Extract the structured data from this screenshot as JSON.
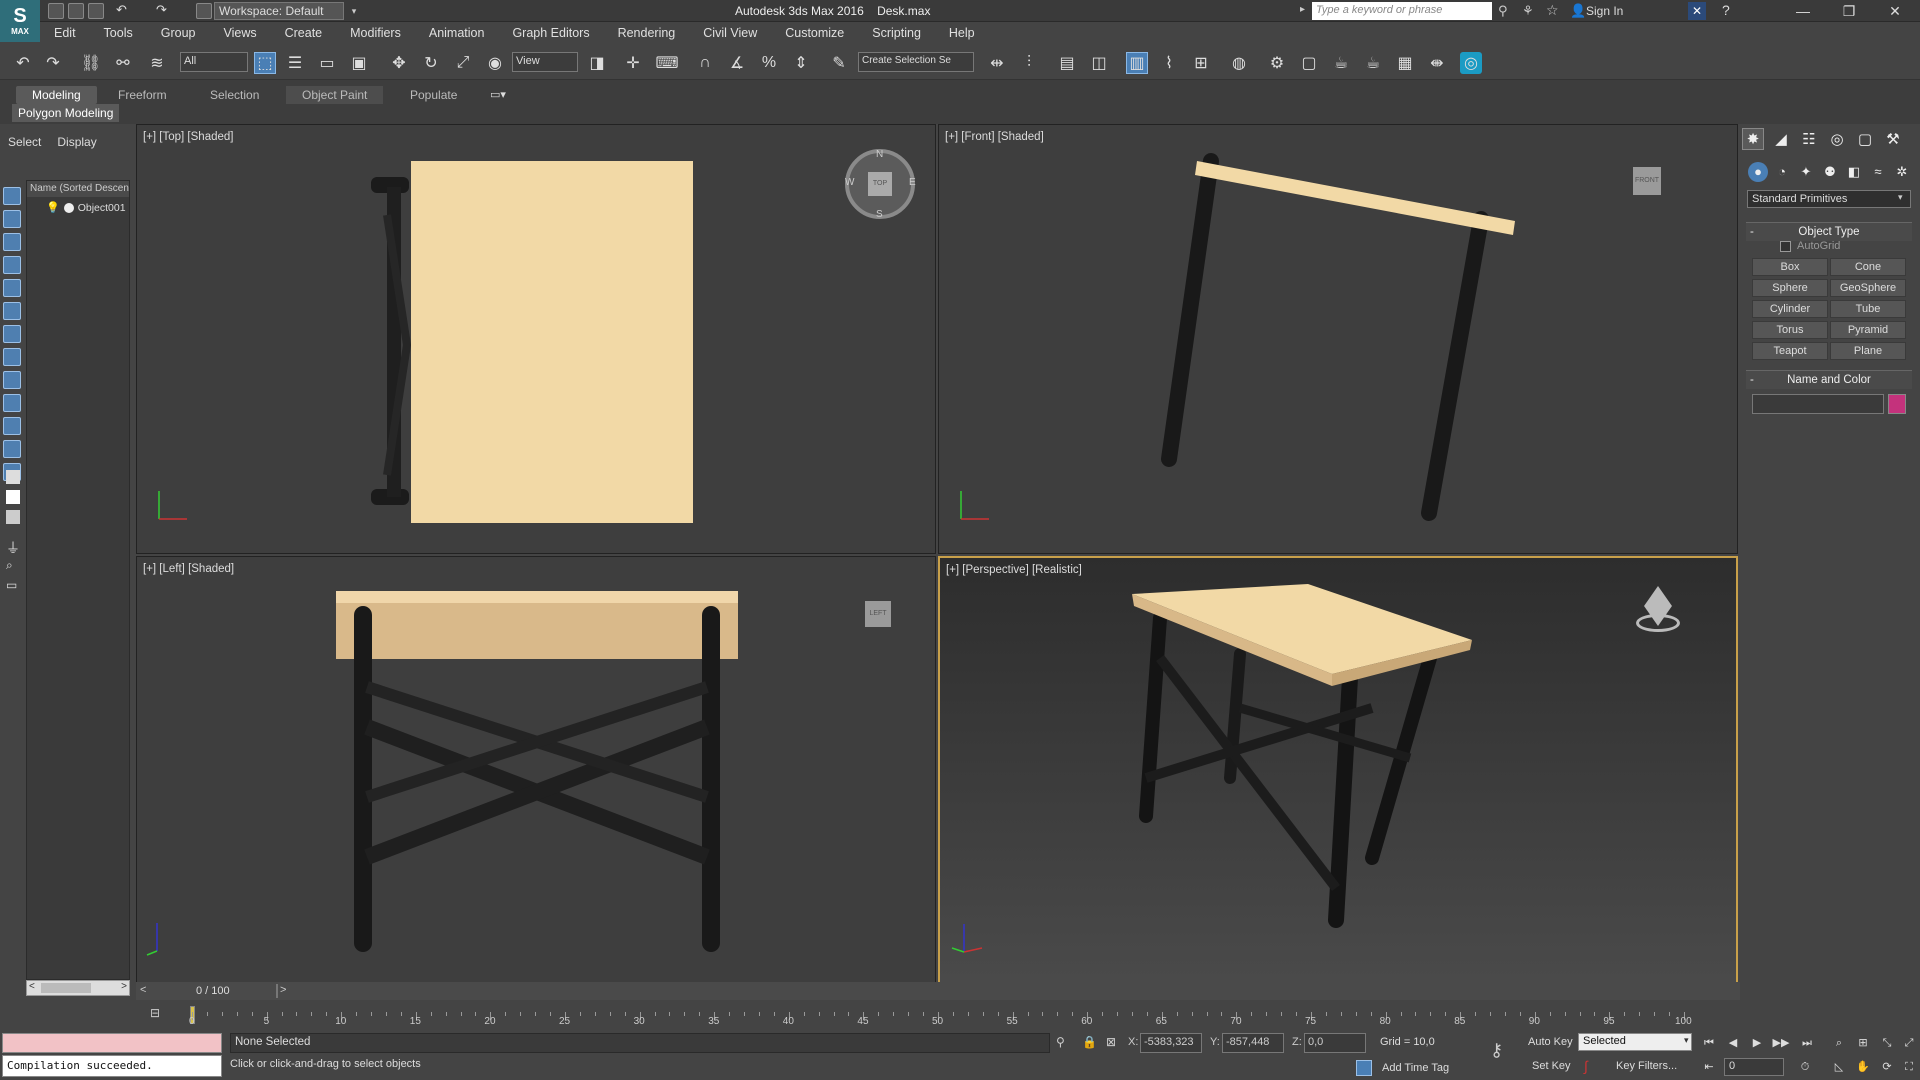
{
  "app": {
    "title": "Autodesk 3ds Max 2016",
    "file": "Desk.max",
    "logo_text": "MAX",
    "workspace": "Workspace: Default",
    "search_placeholder": "Type a keyword or phrase",
    "signin": "Sign In"
  },
  "menu": [
    "Edit",
    "Tools",
    "Group",
    "Views",
    "Create",
    "Modifiers",
    "Animation",
    "Graph Editors",
    "Rendering",
    "Civil View",
    "Customize",
    "Scripting",
    "Help"
  ],
  "toolbar": {
    "selection_filter": "All",
    "ref_coord": "View",
    "named_selection": "Create Selection Se"
  },
  "ribbon": {
    "tabs": [
      "Modeling",
      "Freeform",
      "Selection",
      "Object Paint",
      "Populate"
    ],
    "panel": "Polygon Modeling"
  },
  "scene_explorer": {
    "tabs": [
      "Select",
      "Display"
    ],
    "header": "Name (Sorted Descending)",
    "objects": [
      "Object001"
    ]
  },
  "viewports": {
    "top": "[+] [Top] [Shaded]",
    "front": "[+] [Front] [Shaded]",
    "left": "[+] [Left] [Shaded]",
    "perspective": "[+] [Perspective] [Realistic]",
    "viewcube_top": "TOP",
    "viewcube_front": "FRONT",
    "viewcube_left": "LEFT",
    "compass": {
      "n": "N",
      "s": "S",
      "e": "E",
      "w": "W"
    }
  },
  "command_panel": {
    "category": "Standard Primitives",
    "object_type_title": "Object Type",
    "autogrid": "AutoGrid",
    "primitives": [
      "Box",
      "Cone",
      "Sphere",
      "GeoSphere",
      "Cylinder",
      "Tube",
      "Torus",
      "Pyramid",
      "Teapot",
      "Plane"
    ],
    "name_color_title": "Name and Color",
    "color": "#c4327c"
  },
  "timeline": {
    "slider_label": "0 / 100",
    "ticks": [
      0,
      5,
      10,
      15,
      20,
      25,
      30,
      35,
      40,
      45,
      50,
      55,
      60,
      65,
      70,
      75,
      80,
      85,
      90,
      95,
      100
    ]
  },
  "status": {
    "compile": "Compilation succeeded.",
    "selection": "None Selected",
    "prompt": "Click or click-and-drag to select objects",
    "x_label": "X:",
    "x_value": "-5383,323",
    "y_label": "Y:",
    "y_value": "-857,448",
    "z_label": "Z:",
    "z_value": "0,0",
    "grid": "Grid = 10,0",
    "add_time_tag": "Add Time Tag",
    "auto_key": "Auto Key",
    "set_key": "Set Key",
    "key_mode": "Selected",
    "key_filters": "Key Filters...",
    "frame": "0"
  }
}
